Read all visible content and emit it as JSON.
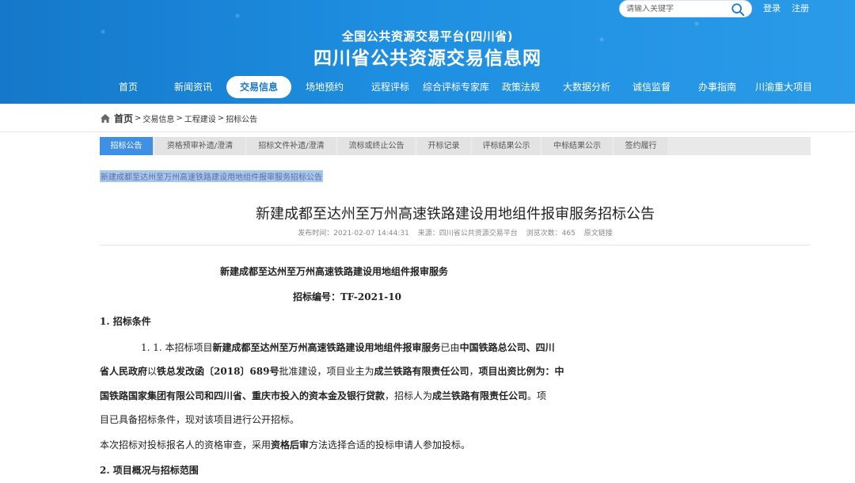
{
  "header": {
    "search_placeholder": "请输入关键字",
    "login": "登录",
    "register": "注册",
    "subtitle": "全国公共资源交易平台(四川省)",
    "title": "四川省公共资源交易信息网"
  },
  "nav": [
    "首页",
    "新闻资讯",
    "交易信息",
    "场地预约",
    "远程评标",
    "综合评标专家库",
    "政策法规",
    "大数据分析",
    "诚信监督",
    "办事指南",
    "川渝重大项目"
  ],
  "nav_active": "交易信息",
  "breadcrumb": {
    "home": "首页",
    "items": [
      "交易信息",
      "工程建设",
      "招标公告"
    ]
  },
  "tabs": [
    "招标公告",
    "资格预审补遗/澄清",
    "招标文件补遗/澄清",
    "流标或终止公告",
    "开标记录",
    "评标结果公示",
    "中标结果公示",
    "签约履行"
  ],
  "tabs_active": "招标公告",
  "selected_link": "新建成都至达州至万州高速铁路建设用地组件报审服务招标公告",
  "article": {
    "title": "新建成都至达州至万州高速铁路建设用地组件报审服务招标公告",
    "meta": {
      "publish_time": "发布时间：2021-02-07 14:44:31",
      "source": "来源：四川省公共资源交易平台",
      "views": "浏览次数：465",
      "original": "原文链接"
    },
    "project_name": "新建成都至达州至万州高速铁路建设用地组件报审服务",
    "bid_number": "招标编号：TF-2021-10",
    "section1": "1. 招标条件",
    "para1": {
      "l1_a": "1. 1. 本招标项目",
      "l1_b": "新建成都至达州至万州高速铁路建设用地组件报审服务",
      "l1_c": "已由",
      "l1_d": "中国铁路总公司、四川",
      "l2_a": "省人民政府",
      "l2_b": "以",
      "l2_c": "铁总发改函〔2018〕689号",
      "l2_d": "批准建设，项目业主为",
      "l2_e": "成兰铁路有限责任公司",
      "l2_f": "，",
      "l2_g": "项目出资比例为：中",
      "l3_a": "国铁路国家集团有限公司和四川省、重庆市投入的资本金及银行贷款",
      "l3_b": "，招标人为",
      "l3_c": "成兰铁路有限责任公司",
      "l3_d": "。项",
      "l4": "目已具备招标条件，现对该项目进行公开招标。"
    },
    "para2": {
      "a": "本次招标对投标报名人的资格审查，采用",
      "b": "资格后审",
      "c": "方法选择合适的投标申请人参加投标。"
    },
    "section2": "2. 项目概况与招标范围"
  },
  "colors": {
    "header_blue": "#1e8ee0",
    "active_tab": "#3f8fe2",
    "nav_active_text": "#1a78c8"
  }
}
